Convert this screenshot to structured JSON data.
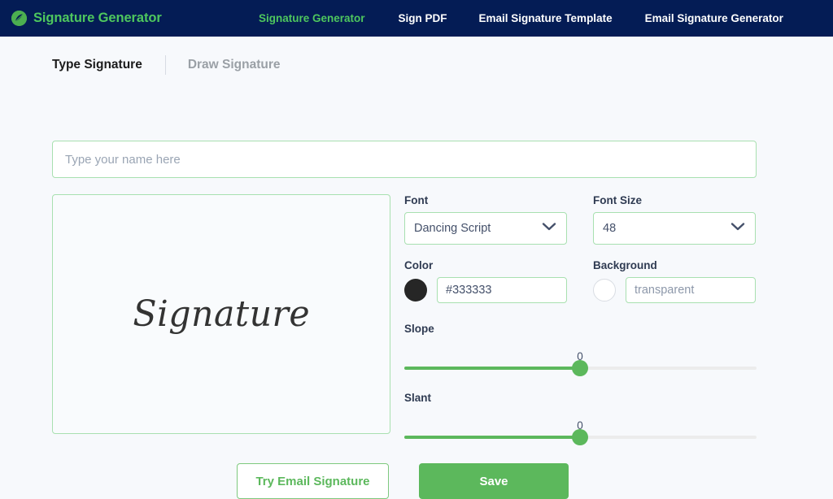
{
  "navbar": {
    "brand": {
      "icon": "signature-logo-icon",
      "text": "Signature Generator",
      "color": "#4ec75e"
    },
    "background_color": "#041c55",
    "links": [
      {
        "label": "Signature Generator",
        "active": true
      },
      {
        "label": "Sign PDF",
        "active": false
      },
      {
        "label": "Email Signature Template",
        "active": false
      },
      {
        "label": "Email Signature Generator",
        "active": false
      }
    ]
  },
  "tabs": [
    {
      "label": "Type Signature",
      "active": true
    },
    {
      "label": "Draw Signature",
      "active": false
    }
  ],
  "name_input": {
    "value": "",
    "placeholder": "Type your name here"
  },
  "preview": {
    "text": "Signature"
  },
  "controls": {
    "font": {
      "label": "Font",
      "value": "Dancing Script",
      "chevron_icon": "chevron-down-icon"
    },
    "font_size": {
      "label": "Font Size",
      "value": "48",
      "chevron_icon": "chevron-down-icon"
    },
    "color": {
      "label": "Color",
      "value": "#333333",
      "swatch_color": "#262626"
    },
    "background": {
      "label": "Background",
      "value": "",
      "placeholder": "transparent",
      "swatch_color": "#ffffff"
    },
    "slope": {
      "label": "Slope",
      "value": "0"
    },
    "slant": {
      "label": "Slant",
      "value": "0"
    }
  },
  "actions": {
    "try_email_signature": "Try Email Signature",
    "save": "Save"
  },
  "theme": {
    "accent_green": "#5cb85c",
    "navy": "#041c55",
    "page_background": "#f7f9fc",
    "border_green": "#a8e0b0"
  }
}
